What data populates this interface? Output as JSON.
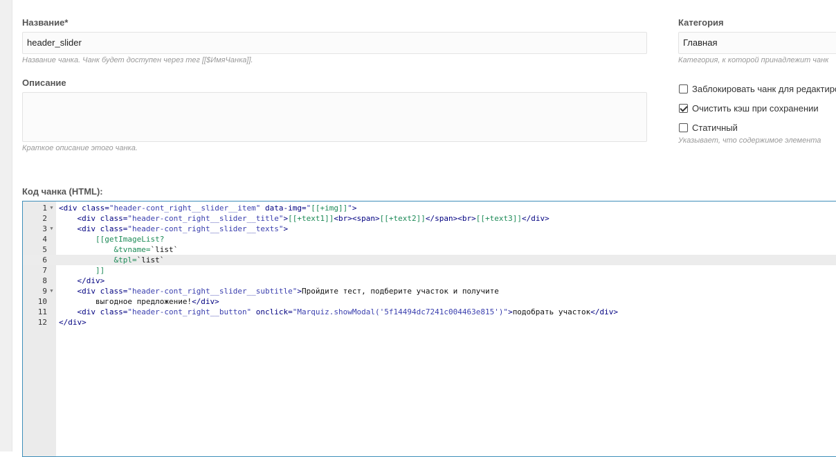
{
  "form": {
    "name_label": "Название*",
    "name_value": "header_slider",
    "name_hint": "Название чанка. Чанк будет доступен через тег [[$ИмяЧанка]].",
    "description_label": "Описание",
    "description_value": "",
    "description_hint": "Краткое описание этого чанка.",
    "category_label": "Категория",
    "category_value": "Главная",
    "category_hint": "Категория, к которой принадлежит чанк",
    "checkboxes": [
      {
        "label": "Заблокировать чанк для редактиро",
        "checked": false
      },
      {
        "label": "Очистить кэш при сохранении",
        "checked": true
      },
      {
        "label": "Статичный",
        "checked": false
      }
    ],
    "static_hint": "Указывает, что содержимое элемента",
    "code_label": "Код чанка (HTML):"
  },
  "editor": {
    "active_line": 6,
    "lines": [
      {
        "n": "1",
        "fold": true,
        "indent": "",
        "tokens": [
          [
            "tag",
            "<div "
          ],
          [
            "tag",
            "class="
          ],
          [
            "str",
            "\"header-cont_right__slider__item\""
          ],
          [
            "tag",
            " data-img="
          ],
          [
            "str",
            "\""
          ],
          [
            "mx",
            "[[+img]]"
          ],
          [
            "str",
            "\""
          ],
          [
            "tag",
            ">"
          ]
        ]
      },
      {
        "n": "2",
        "fold": false,
        "indent": "    ",
        "tokens": [
          [
            "tag",
            "<div "
          ],
          [
            "tag",
            "class="
          ],
          [
            "str",
            "\"header-cont_right__slider__title\""
          ],
          [
            "tag",
            ">"
          ],
          [
            "mx",
            "[[+text1]]"
          ],
          [
            "tag",
            "<br>"
          ],
          [
            "tag",
            "<span>"
          ],
          [
            "mx",
            "[[+text2]]"
          ],
          [
            "tag",
            "</span>"
          ],
          [
            "tag",
            "<br>"
          ],
          [
            "mx",
            "[[+text3]]"
          ],
          [
            "tag",
            "</div>"
          ]
        ]
      },
      {
        "n": "3",
        "fold": true,
        "indent": "    ",
        "tokens": [
          [
            "tag",
            "<div "
          ],
          [
            "tag",
            "class="
          ],
          [
            "str",
            "\"header-cont_right__slider__texts\""
          ],
          [
            "tag",
            ">"
          ]
        ]
      },
      {
        "n": "4",
        "fold": false,
        "indent": "        ",
        "tokens": [
          [
            "mx",
            "[[getImageList?"
          ]
        ]
      },
      {
        "n": "5",
        "fold": false,
        "indent": "            ",
        "tokens": [
          [
            "mx",
            "&tvname="
          ],
          [
            "txt",
            "`list`"
          ]
        ]
      },
      {
        "n": "6",
        "fold": false,
        "indent": "            ",
        "tokens": [
          [
            "mx",
            "&tpl="
          ],
          [
            "txt",
            "`list`"
          ]
        ]
      },
      {
        "n": "7",
        "fold": false,
        "indent": "        ",
        "tokens": [
          [
            "mx",
            "]]"
          ]
        ]
      },
      {
        "n": "8",
        "fold": false,
        "indent": "    ",
        "tokens": [
          [
            "tag",
            "</div>"
          ]
        ]
      },
      {
        "n": "9",
        "fold": true,
        "indent": "    ",
        "tokens": [
          [
            "tag",
            "<div "
          ],
          [
            "tag",
            "class="
          ],
          [
            "str",
            "\"header-cont_right__slider__subtitle\""
          ],
          [
            "tag",
            ">"
          ],
          [
            "txt",
            "Пройдите тест, подберите участок и получите"
          ]
        ]
      },
      {
        "n": "10",
        "fold": false,
        "indent": "        ",
        "tokens": [
          [
            "txt",
            "выгодное предложение!"
          ],
          [
            "tag",
            "</div>"
          ]
        ]
      },
      {
        "n": "11",
        "fold": false,
        "indent": "    ",
        "tokens": [
          [
            "tag",
            "<div "
          ],
          [
            "tag",
            "class="
          ],
          [
            "str",
            "\"header-cont_right__button\""
          ],
          [
            "tag",
            " onclick="
          ],
          [
            "str",
            "\"Marquiz.showModal('5f14494dc7241c004463e815')\""
          ],
          [
            "tag",
            ">"
          ],
          [
            "txt",
            "подобрать участок"
          ],
          [
            "tag",
            "</div>"
          ]
        ]
      },
      {
        "n": "12",
        "fold": false,
        "indent": "",
        "tokens": [
          [
            "tag",
            "</div>"
          ]
        ]
      }
    ]
  }
}
